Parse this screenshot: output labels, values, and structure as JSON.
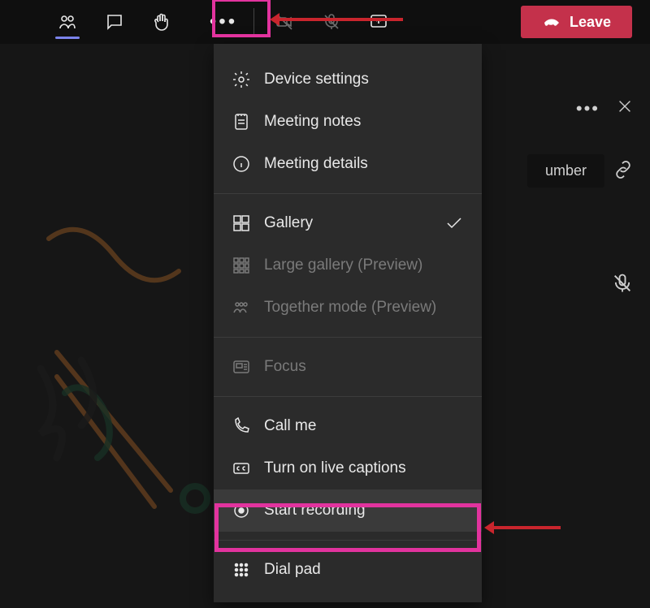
{
  "colors": {
    "accent_pink": "#e2339e",
    "arrow_red": "#c9252d",
    "leave_red": "#c4314b",
    "underline": "#7b83eb"
  },
  "toolbar": {
    "leave_label": "Leave"
  },
  "panel": {
    "partial_button_label": "umber"
  },
  "menu": {
    "device_settings": "Device settings",
    "meeting_notes": "Meeting notes",
    "meeting_details": "Meeting details",
    "gallery": "Gallery",
    "large_gallery": "Large gallery (Preview)",
    "together_mode": "Together mode (Preview)",
    "focus": "Focus",
    "call_me": "Call me",
    "live_captions": "Turn on live captions",
    "start_recording": "Start recording",
    "dial_pad": "Dial pad"
  }
}
